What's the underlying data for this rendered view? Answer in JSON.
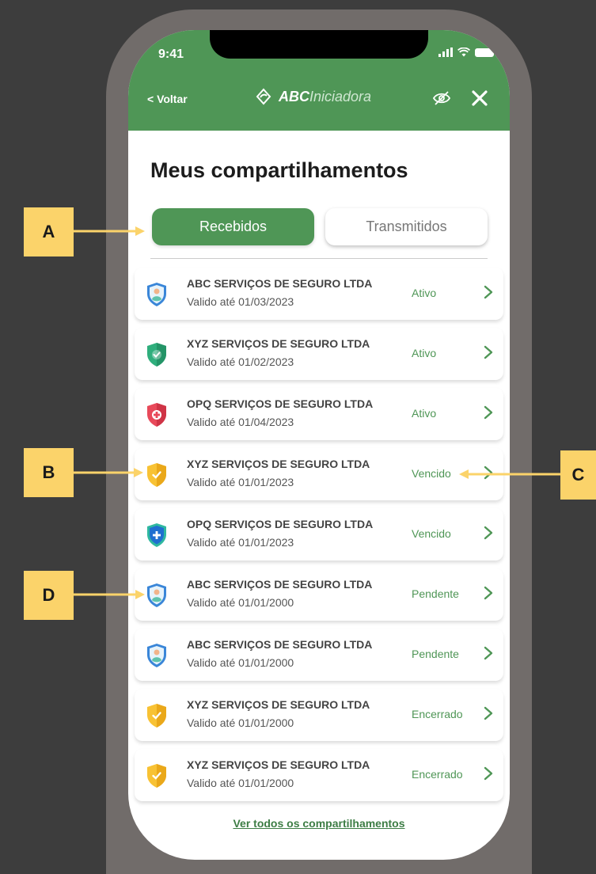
{
  "status_bar": {
    "time": "9:41"
  },
  "header": {
    "back_label": "< Voltar",
    "brand_strong": "ABC",
    "brand_light": "Iniciadora"
  },
  "page_title": "Meus compartilhamentos",
  "tabs": [
    {
      "label": "Recebidos",
      "active": true
    },
    {
      "label": "Transmitidos",
      "active": false
    }
  ],
  "items": [
    {
      "company": "ABC SERVIÇOS DE SEGURO LTDA",
      "validity": "Valido até 01/03/2023",
      "status": "Ativo",
      "icon": "user-shield-icon"
    },
    {
      "company": "XYZ SERVIÇOS DE SEGURO LTDA",
      "validity": "Valido até 01/02/2023",
      "status": "Ativo",
      "icon": "green-check-shield-icon"
    },
    {
      "company": "OPQ SERVIÇOS DE SEGURO LTDA",
      "validity": "Valido até 01/04/2023",
      "status": "Ativo",
      "icon": "red-cross-shield-icon"
    },
    {
      "company": "XYZ SERVIÇOS DE SEGURO LTDA",
      "validity": "Valido até 01/01/2023",
      "status": "Vencido",
      "icon": "yellow-check-shield-icon"
    },
    {
      "company": "OPQ SERVIÇOS DE SEGURO LTDA",
      "validity": "Valido até 01/01/2023",
      "status": "Vencido",
      "icon": "blue-plus-shield-icon"
    },
    {
      "company": "ABC SERVIÇOS DE SEGURO LTDA",
      "validity": "Valido até 01/01/2000",
      "status": "Pendente",
      "icon": "user-shield-icon"
    },
    {
      "company": "ABC SERVIÇOS DE SEGURO LTDA",
      "validity": "Valido até 01/01/2000",
      "status": "Pendente",
      "icon": "user-shield-icon"
    },
    {
      "company": "XYZ SERVIÇOS DE SEGURO LTDA",
      "validity": "Valido até 01/01/2000",
      "status": "Encerrado",
      "icon": "yellow-check-shield-icon"
    },
    {
      "company": "XYZ SERVIÇOS DE SEGURO LTDA",
      "validity": "Valido até 01/01/2000",
      "status": "Encerrado",
      "icon": "yellow-check-shield-icon"
    }
  ],
  "see_all_label": "Ver todos os compartilhamentos",
  "annotations": [
    "A",
    "B",
    "C",
    "D"
  ],
  "colors": {
    "brand_green": "#4f9656",
    "marker_yellow": "#fbd36a",
    "frame_gray": "#716c6a",
    "background": "#3d3d3d"
  }
}
